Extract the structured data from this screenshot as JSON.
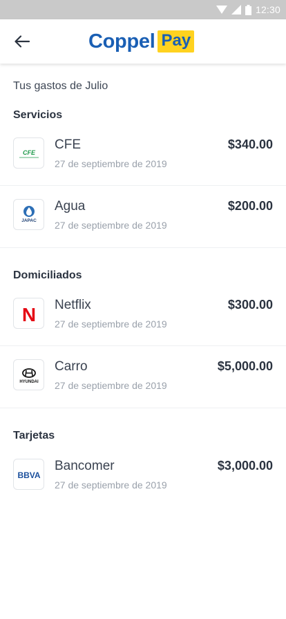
{
  "status_bar": {
    "time": "12:30"
  },
  "header": {
    "logo_word": "Coppel",
    "logo_badge": "Pay"
  },
  "month_title": "Tus gastos de Julio",
  "sections": [
    {
      "title": "Servicios",
      "items": [
        {
          "name": "CFE",
          "date": "27 de septiembre de 2019",
          "amount": "$340.00",
          "logo": "cfe-logo"
        },
        {
          "name": "Agua",
          "date": "27 de septiembre de 2019",
          "amount": "$200.00",
          "logo": "japac-logo"
        }
      ]
    },
    {
      "title": "Domiciliados",
      "items": [
        {
          "name": "Netflix",
          "date": "27 de septiembre de 2019",
          "amount": "$300.00",
          "logo": "netflix-logo"
        },
        {
          "name": "Carro",
          "date": "27 de septiembre de 2019",
          "amount": "$5,000.00",
          "logo": "hyundai-logo"
        }
      ]
    },
    {
      "title": "Tarjetas",
      "items": [
        {
          "name": "Bancomer",
          "date": "27 de septiembre de 2019",
          "amount": "$3,000.00",
          "logo": "bbva-logo"
        }
      ]
    }
  ],
  "logo_text": {
    "cfe": "CFE",
    "japac": "JAPAC",
    "netflix": "N",
    "hyundai": "HYUNDAI",
    "bbva": "BBVA"
  },
  "colors": {
    "brand_blue": "#1a5fb4",
    "brand_yellow": "#ffd21f",
    "netflix_red": "#e50914",
    "cfe_green": "#1f9a4b",
    "bbva_blue": "#1a4f9c",
    "status_bar": "#c9c9c9"
  }
}
